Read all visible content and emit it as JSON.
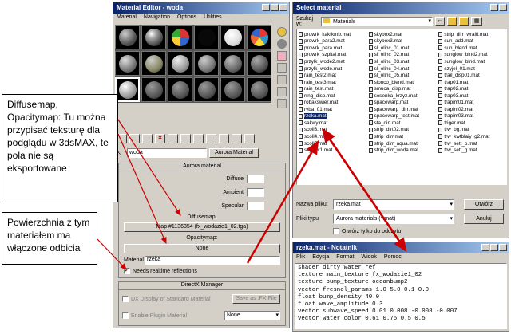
{
  "material_editor": {
    "title": "Material Editor - woda",
    "menu": [
      "Material",
      "Navigation",
      "Options",
      "Utilities"
    ],
    "material_name": "woda",
    "material_type": "Aurora Material",
    "rollout_title": "Aurora material",
    "diffuse_label": "Diffuse",
    "ambient_label": "Ambient",
    "specular_label": "Specular",
    "diffusemap_label": "Diffusemap:",
    "diffusemap_value": "Map #1136354 (fx_wodazie1_02.tga)",
    "opacitymap_label": "Opacitymap:",
    "opacitymap_value": "None",
    "material_label": "Material",
    "material_value": "rzeka",
    "reflections_label": "Needs realtime reflections",
    "directx_title": "DirectX Manager",
    "dx_display_label": "DX Display of Standard Material",
    "save_fx_label": "Save as .FX File",
    "plugin_label": "Enable Plugin Material",
    "plugin_value": "None"
  },
  "select_material": {
    "title": "Select material",
    "lookin_label": "Szukaj w:",
    "lookin_value": "Materials",
    "files": [
      "prowrk_kaktkmb.mat",
      "prowrk_para2.mat",
      "prowrk_para.mat",
      "prowrk_szpital.mat",
      "przylk_wode2.mat",
      "przylk_wode.mat",
      "rain_test2.mat",
      "rain_test3.mat",
      "rain_test.mat",
      "rrng_disp.mat",
      "robakswier.mat",
      "ryba_01.mat",
      "rzeka.mat",
      "sakwy.mat",
      "scoll3.mat",
      "scoll4.mat",
      "scoll5.mat",
      "skybox1.mat",
      "skybox2.mat",
      "skybox3.mat",
      "sl_olinc_01.mat",
      "sl_olinc_02.mat",
      "sl_olinc_03.mat",
      "sl_olinc_04.mat",
      "sl_olinc_05.mat",
      "slonco_blend.mat",
      "smuca_disp.mat",
      "sosenka_krzyz.mat",
      "spacewarp.mat",
      "spacewarp_dirr.mat",
      "spacewarp_test.mat",
      "sta_dirt.mat",
      "strip_dirt02.mat",
      "strip_dirr.mat",
      "strip_dirr_aqua.mat",
      "strip_dirr_woda.mat",
      "strip_dirr_wraitl.mat",
      "sun_add.mat",
      "sun_blend.mat",
      "sunglow_blnd2.mat",
      "sunglow_blnd.mat",
      "szyjel_01.mat",
      "trail_disp01.mat",
      "trap01.mat",
      "trap02.mat",
      "trap03.mat",
      "trapim01.mat",
      "trapim02.mat",
      "trapim03.mat",
      "triger.mat",
      "trw_bg.mat",
      "trw_kwtblaiy_g2.mat",
      "trw_sett_b.mat",
      "trw_sett_g.mat"
    ],
    "selected_index": 12,
    "filename_label": "Nazwa pliku:",
    "filename_value": "rzeka.mat",
    "filetype_label": "Pliki typu",
    "filetype_value": "Aurora materials (*.mat)",
    "readonly_label": "Otwórz tylko do odczytu",
    "open_button": "Otwórz",
    "cancel_button": "Anuluj"
  },
  "notepad": {
    "title": "rzeka.mat - Notatnik",
    "menu": [
      "Plik",
      "Edycja",
      "Format",
      "Widok",
      "Pomoc"
    ],
    "lines": [
      "shader dirty_water_ref",
      "texture main_texture fx_wodazie1_02",
      "texture bump_texture oceanbump2",
      "vector fresnel_params 1.0 5.0 0.1 0.0",
      "float bump_density 40.0",
      "float wave_amplitude 0.3",
      "vector subwave_speed 0.01 0.008 -0.008 -0.007",
      "vector water_color 0.61 0.75 0.5 0.5"
    ]
  },
  "notes": {
    "note1": "Diffusemap, Opacitymap: Tu można przypisać teksturę dla podglądu w 3dsMAX, te pola nie są eksportowane",
    "note2": "Powierzchnia z tym materiałem ma włączone odbicia"
  },
  "colors": {
    "arrow": "#cc0000",
    "titlebar": "#0a246a",
    "face": "#d4d0c8"
  }
}
